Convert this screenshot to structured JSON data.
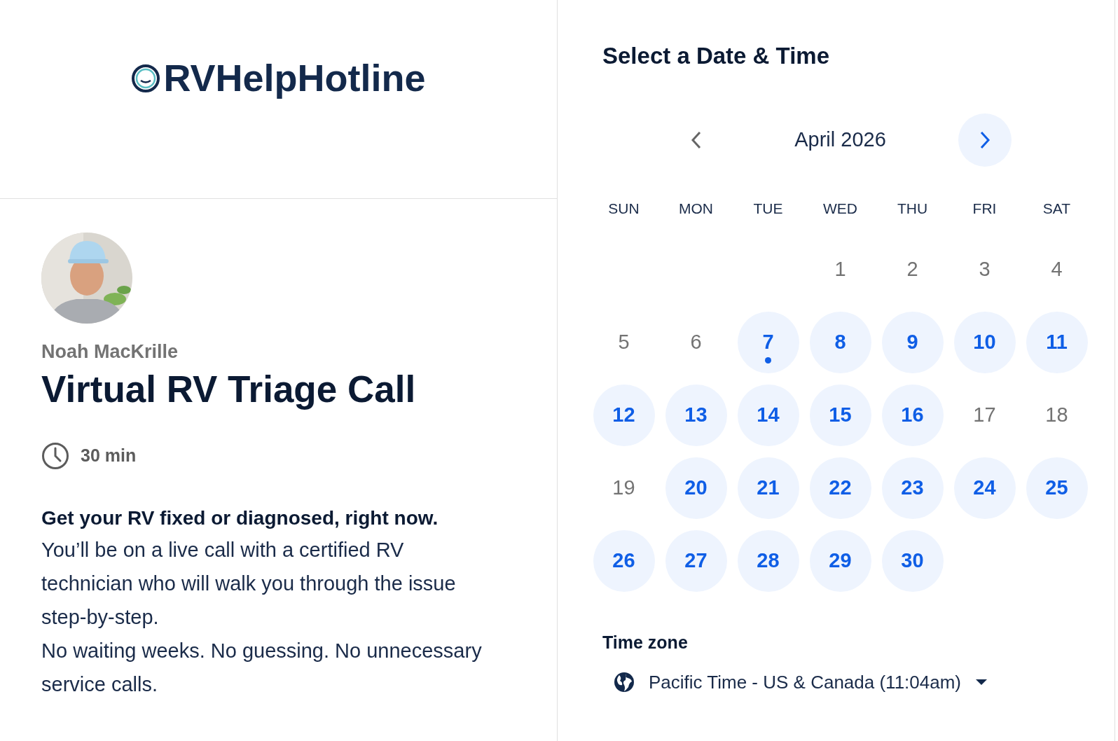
{
  "brand": {
    "name": "RVHelpHotline"
  },
  "host": {
    "name": "Noah MacKrille"
  },
  "event": {
    "title": "Virtual RV Triage Call",
    "duration": "30 min",
    "headline": "Get your RV fixed or diagnosed, right now.",
    "paragraphs": [
      "You’ll be on a live call with a certified RV technician who will walk you through the issue step-by-step.",
      "No waiting weeks. No guessing. No unnecessary service calls."
    ]
  },
  "scheduler": {
    "title": "Select a Date & Time",
    "month": "April 2026",
    "weekdays": [
      "SUN",
      "MON",
      "TUE",
      "WED",
      "THU",
      "FRI",
      "SAT"
    ],
    "days": [
      {
        "label": "1",
        "available": false,
        "today": false
      },
      {
        "label": "2",
        "available": false,
        "today": false
      },
      {
        "label": "3",
        "available": false,
        "today": false
      },
      {
        "label": "4",
        "available": false,
        "today": false
      },
      {
        "label": "5",
        "available": false,
        "today": false
      },
      {
        "label": "6",
        "available": false,
        "today": false
      },
      {
        "label": "7",
        "available": true,
        "today": true
      },
      {
        "label": "8",
        "available": true,
        "today": false
      },
      {
        "label": "9",
        "available": true,
        "today": false
      },
      {
        "label": "10",
        "available": true,
        "today": false
      },
      {
        "label": "11",
        "available": true,
        "today": false
      },
      {
        "label": "12",
        "available": true,
        "today": false
      },
      {
        "label": "13",
        "available": true,
        "today": false
      },
      {
        "label": "14",
        "available": true,
        "today": false
      },
      {
        "label": "15",
        "available": true,
        "today": false
      },
      {
        "label": "16",
        "available": true,
        "today": false
      },
      {
        "label": "17",
        "available": false,
        "today": false
      },
      {
        "label": "18",
        "available": false,
        "today": false
      },
      {
        "label": "19",
        "available": false,
        "today": false
      },
      {
        "label": "20",
        "available": true,
        "today": false
      },
      {
        "label": "21",
        "available": true,
        "today": false
      },
      {
        "label": "22",
        "available": true,
        "today": false
      },
      {
        "label": "23",
        "available": true,
        "today": false
      },
      {
        "label": "24",
        "available": true,
        "today": false
      },
      {
        "label": "25",
        "available": true,
        "today": false
      },
      {
        "label": "26",
        "available": true,
        "today": false
      },
      {
        "label": "27",
        "available": true,
        "today": false
      },
      {
        "label": "28",
        "available": true,
        "today": false
      },
      {
        "label": "29",
        "available": true,
        "today": false
      },
      {
        "label": "30",
        "available": true,
        "today": false
      }
    ],
    "timezone": {
      "label": "Time zone",
      "value": "Pacific Time - US & Canada (11:04am)"
    }
  }
}
